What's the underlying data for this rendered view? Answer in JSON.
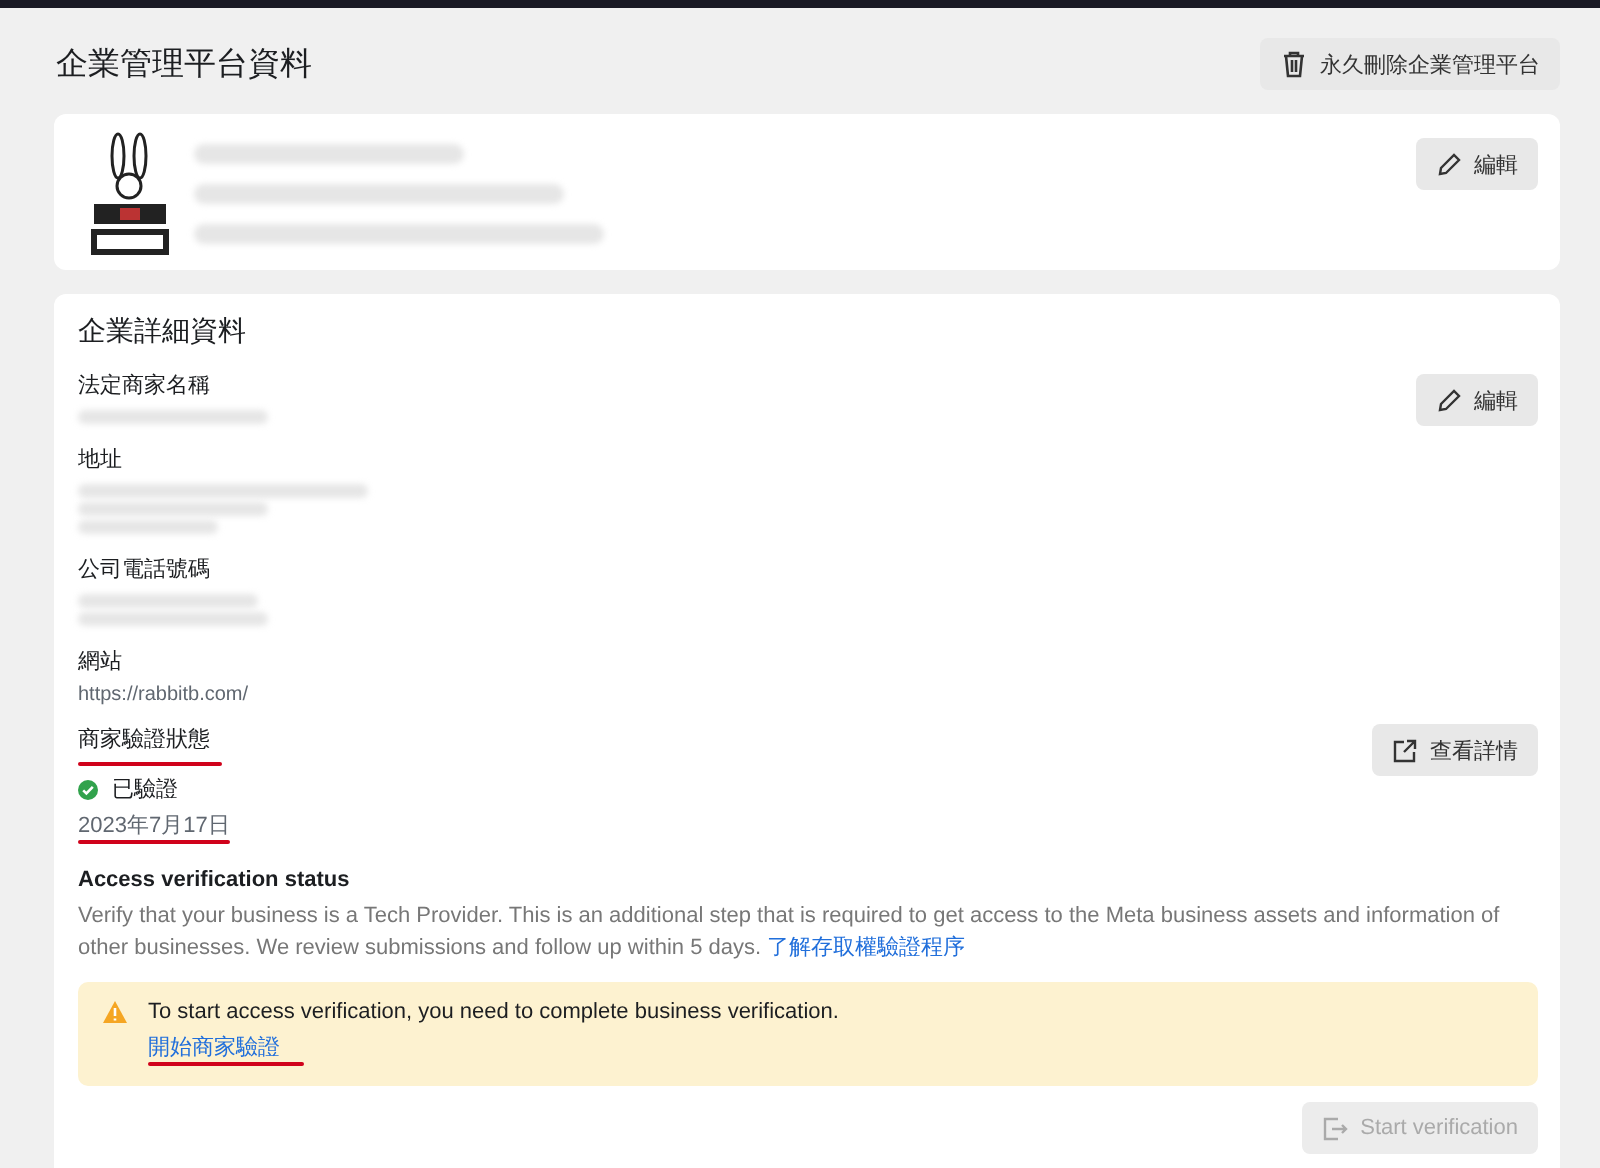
{
  "page_title": "企業管理平台資料",
  "delete_button": {
    "label": "永久刪除企業管理平台"
  },
  "profile_card": {
    "edit_button": {
      "label": "編輯"
    }
  },
  "details_card": {
    "title": "企業詳細資料",
    "edit_button": {
      "label": "編輯"
    },
    "fields": [
      {
        "label": "法定商家名稱",
        "kind": "redacted"
      },
      {
        "label": "地址",
        "kind": "redacted"
      },
      {
        "label": "公司電話號碼",
        "kind": "redacted"
      },
      {
        "label": "網站",
        "kind": "link",
        "value": "https://rabbitb.com/"
      }
    ],
    "verification": {
      "label": "商家驗證狀態",
      "status": "已驗證",
      "verified": true,
      "date": "2023年7月17日",
      "details_button": {
        "label": "查看詳情"
      }
    },
    "access": {
      "title": "Access verification status",
      "description": "Verify that your business is a Tech Provider. This is an additional step that is required to get access to the Meta business assets and information of other businesses. We review submissions and follow up within 5 days.",
      "link": "了解存取權驗證程序",
      "warning": {
        "text": "To start access verification, you need to complete business verification.",
        "link": "開始商家驗證"
      },
      "start_button": {
        "label": "Start verification",
        "disabled": true
      }
    }
  }
}
